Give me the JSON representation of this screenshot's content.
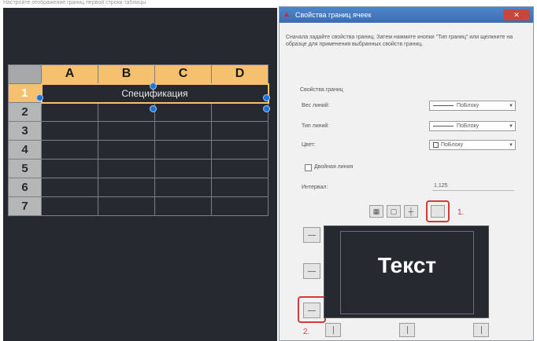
{
  "caption": "Настройте отображение границ первой строки таблицы",
  "table": {
    "columns": [
      "A",
      "B",
      "C",
      "D"
    ],
    "rows": [
      "1",
      "2",
      "3",
      "4",
      "5",
      "6",
      "7"
    ],
    "title_cell": "Спецификация"
  },
  "dialog": {
    "title": "Свойства границ ячеек",
    "close_label": "✕",
    "instructions": "Сначала задайте свойства границ. Затем нажмите кнопки \"Тип границ\" или щелкните на образце для применения выбранных свойств границ.",
    "group_label": "Свойства границ",
    "props": [
      {
        "label": "Вес линий:",
        "value": "ПоБлоку"
      },
      {
        "label": "Тип линий:",
        "value": "ПоБлоку"
      },
      {
        "label": "Цвет:",
        "value": "ПоБлоку"
      }
    ],
    "double_line_label": "Двойная линия",
    "spacing_label": "Интервал:",
    "spacing_value": "1.125",
    "preview_text": "Текст",
    "steps": [
      "1.",
      "2."
    ]
  },
  "colors": {
    "canvas_bg": "#262a30",
    "header_highlight": "#f5c16e",
    "grip_blue": "#1f74d6",
    "annotation_red": "#d43b35",
    "titlebar_blue": "#3a6eb2"
  },
  "icons": {
    "border_buttons": [
      "grid-all-icon",
      "grid-outside-icon",
      "grid-inside-icon",
      "no-border-icon"
    ]
  }
}
